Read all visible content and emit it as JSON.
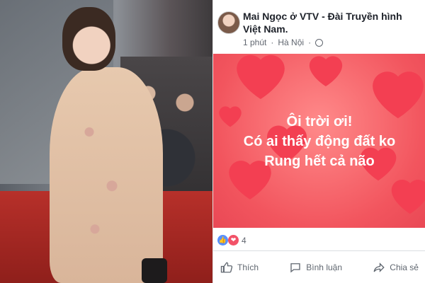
{
  "post": {
    "author": "Mai Ngọc ở VTV - Đài Truyền hình Việt Nam.",
    "time": "1 phút",
    "location": "Hà Nội",
    "status_lines": [
      "Ôi trời ơi!",
      "Có ai thấy động đất ko",
      "Rung hết cả não"
    ],
    "reaction_count": "4",
    "actions": {
      "like": "Thích",
      "comment": "Bình luận",
      "share": "Chia sẻ"
    },
    "colors": {
      "background": "#f2555e",
      "heart": "#f33f52",
      "link_blue": "#365899"
    }
  }
}
